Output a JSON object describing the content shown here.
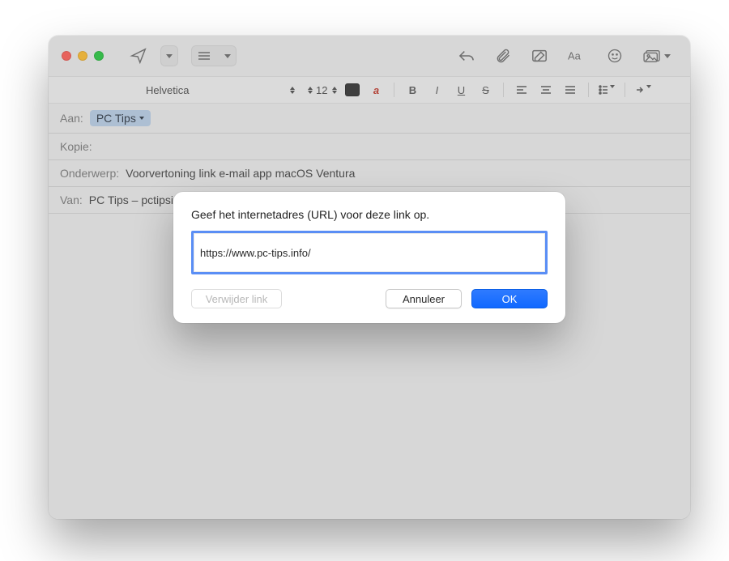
{
  "format": {
    "font": "Helvetica",
    "size": "12"
  },
  "headers": {
    "to_label": "Aan:",
    "to_value": "PC Tips",
    "cc_label": "Kopie:",
    "subject_label": "Onderwerp:",
    "subject_value": "Voorvertoning link e-mail app macOS Ventura",
    "from_label": "Van:",
    "from_value": "PC Tips – pctipsin"
  },
  "modal": {
    "title": "Geef het internetadres (URL) voor deze link op.",
    "url": "https://www.pc-tips.info/",
    "remove_label": "Verwijder link",
    "cancel_label": "Annuleer",
    "ok_label": "OK"
  }
}
